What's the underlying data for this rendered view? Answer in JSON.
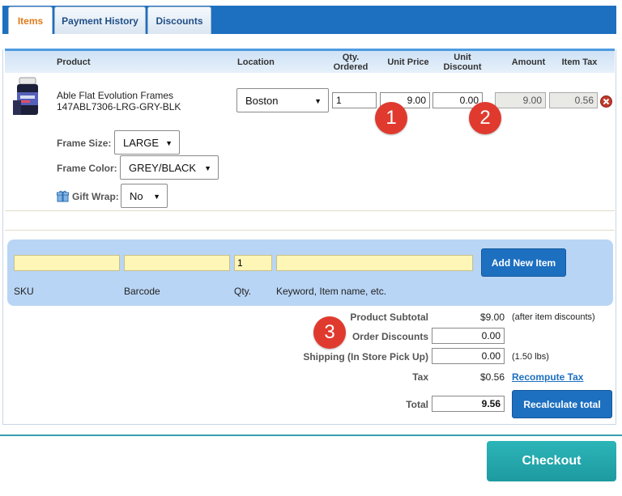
{
  "tabs": [
    {
      "label": "Items",
      "active": true
    },
    {
      "label": "Payment History",
      "active": false
    },
    {
      "label": "Discounts",
      "active": false
    }
  ],
  "columns": {
    "product": "Product",
    "location": "Location",
    "qty_ordered_l1": "Qty.",
    "qty_ordered_l2": "Ordered",
    "unit_price": "Unit Price",
    "unit_discount_l1": "Unit",
    "unit_discount_l2": "Discount",
    "amount": "Amount",
    "item_tax": "Item Tax"
  },
  "item": {
    "name": "Able Flat Evolution Frames",
    "sku": "147ABL7306-LRG-GRY-BLK",
    "location": "Boston",
    "qty": "1",
    "unit_price": "9.00",
    "unit_discount": "0.00",
    "amount": "9.00",
    "item_tax": "0.56",
    "options": [
      {
        "label": "Frame Size:",
        "value": "LARGE"
      },
      {
        "label": "Frame Color:",
        "value": "GREY/BLACK"
      },
      {
        "label": "Gift Wrap:",
        "value": "No"
      }
    ]
  },
  "badges": [
    "1",
    "2",
    "3"
  ],
  "add_item": {
    "qty_default": "1",
    "button": "Add New Item",
    "labels": {
      "sku": "SKU",
      "barcode": "Barcode",
      "qty": "Qty.",
      "keyword": "Keyword, Item name, etc."
    }
  },
  "totals": {
    "product_subtotal_label": "Product Subtotal",
    "product_subtotal": "$9.00",
    "product_subtotal_note": "(after item discounts)",
    "order_discounts_label": "Order Discounts",
    "order_discounts": "0.00",
    "shipping_label": "Shipping (In Store Pick Up)",
    "shipping": "0.00",
    "shipping_note": "(1.50 lbs)",
    "tax_label": "Tax",
    "tax": "$0.56",
    "recompute_tax": "Recompute Tax",
    "total_label": "Total",
    "total": "9.56",
    "recalculate": "Recalculate total"
  },
  "checkout": "Checkout",
  "colors": {
    "accent": "#1d6fc0",
    "badge": "#e03a2f",
    "checkout": "#22a8ad",
    "highlight": "#fdf6b6"
  }
}
